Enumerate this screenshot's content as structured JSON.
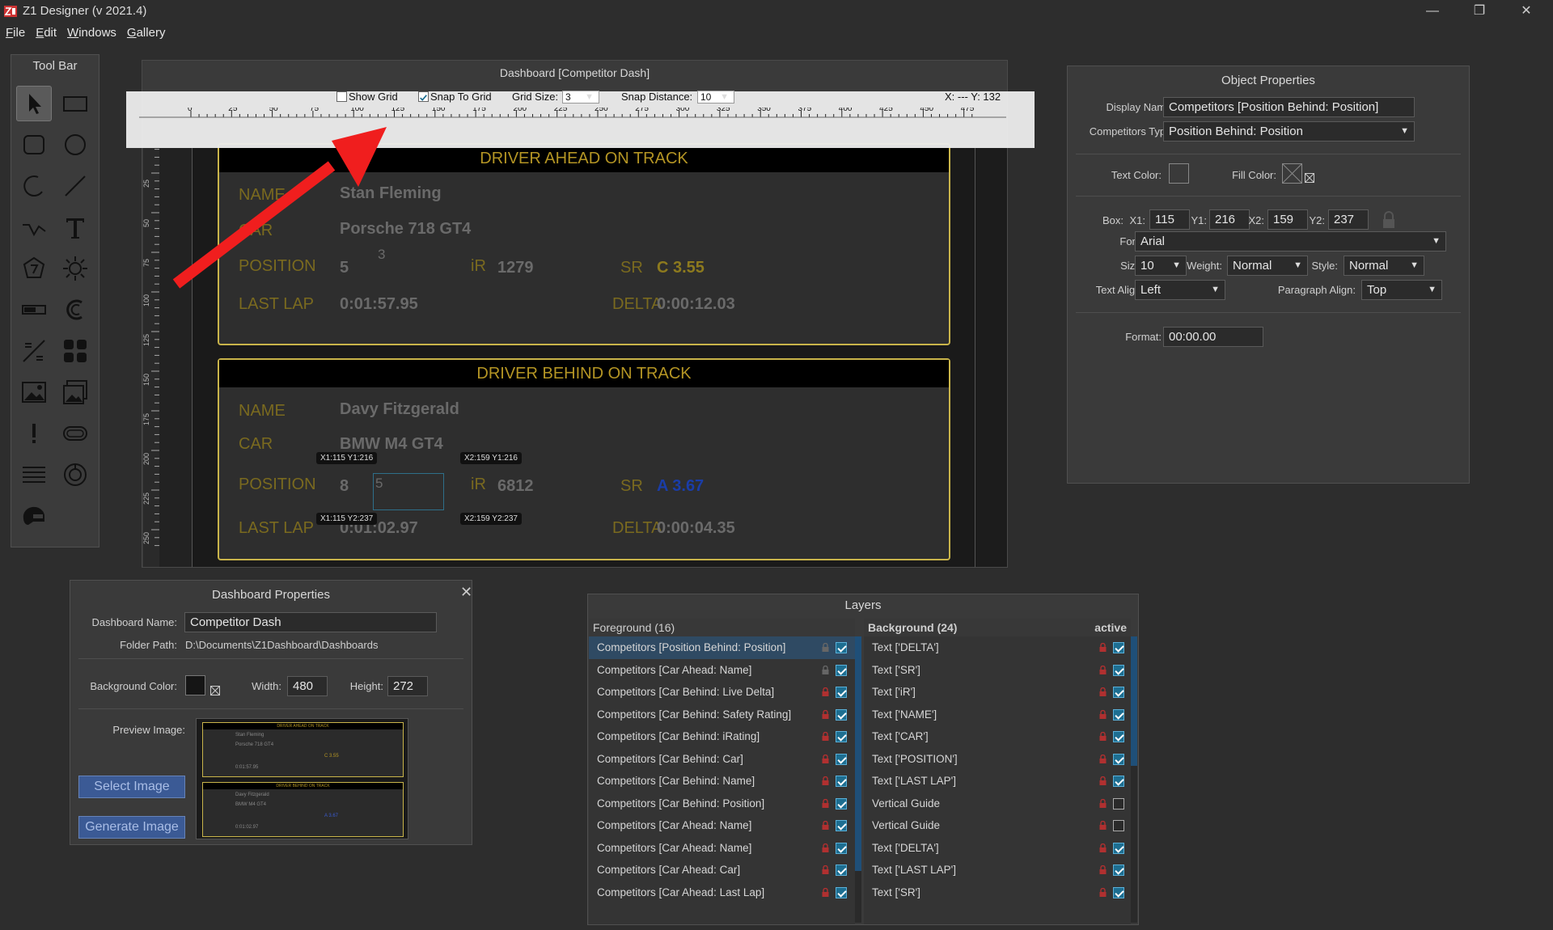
{
  "window": {
    "title": "Z1 Designer (v 2021.4)",
    "minimize": "—",
    "restore": "❐",
    "close": "✕"
  },
  "menu": [
    "File",
    "Edit",
    "Windows",
    "Gallery"
  ],
  "toolbar": {
    "title": "Tool Bar"
  },
  "editor": {
    "title": "Dashboard [Competitor Dash]",
    "show_grid_label": "Show Grid",
    "snap_label": "Snap To Grid",
    "grid_size_label": "Grid Size:",
    "grid_size": "3",
    "snap_distance_label": "Snap Distance:",
    "snap_distance": "10",
    "coords": "X: --- Y: 132",
    "ruler_ticks": [
      "0",
      "25",
      "50",
      "75",
      "100",
      "125",
      "150",
      "175",
      "200",
      "225",
      "250",
      "275",
      "300",
      "325",
      "350",
      "375",
      "400",
      "425",
      "450",
      "475"
    ],
    "vruler_ticks": [
      "0",
      "25",
      "50",
      "75",
      "100",
      "125",
      "150",
      "175",
      "200",
      "225",
      "250"
    ]
  },
  "card_ahead": {
    "header": "DRIVER AHEAD ON TRACK",
    "name_lbl": "NAME",
    "name": "Stan Fleming",
    "car_lbl": "CAR",
    "car": "Porsche 718 GT4",
    "pos_lbl": "POSITION",
    "pos": "5",
    "pos_sub": "3",
    "ir_lbl": "iR",
    "ir": "1279",
    "sr_lbl": "SR",
    "sr": "C 3.55",
    "lap_lbl": "LAST LAP",
    "lap": "0:01:57.95",
    "delta_lbl": "DELTA",
    "delta": "0:00:12.03"
  },
  "card_behind": {
    "header": "DRIVER BEHIND ON TRACK",
    "name_lbl": "NAME",
    "name": "Davy Fitzgerald",
    "car_lbl": "CAR",
    "car": "BMW M4 GT4",
    "pos_lbl": "POSITION",
    "pos": "8",
    "pos_sub": "5",
    "ir_lbl": "iR",
    "ir": "6812",
    "sr_lbl": "SR",
    "sr": "A 3.67",
    "lap_lbl": "LAST LAP",
    "lap": "0:01:02.97",
    "delta_lbl": "DELTA",
    "delta": "0:00:04.35"
  },
  "handles": {
    "tl": "X1:115 Y1:216",
    "tr": "X2:159 Y1:216",
    "bl": "X1:115 Y2:237",
    "br": "X2:159 Y2:237"
  },
  "objprops": {
    "title": "Object Properties",
    "display_name_lbl": "Display Name:",
    "display_name": "Competitors [Position Behind: Position]",
    "comp_type_lbl": "Competitors Type:",
    "comp_type": "Position Behind: Position",
    "text_color_lbl": "Text Color:",
    "fill_color_lbl": "Fill Color:",
    "box_lbl": "Box:",
    "x1_lbl": "X1:",
    "x1": "115",
    "y1_lbl": "Y1:",
    "y1": "216",
    "x2_lbl": "X2:",
    "x2": "159",
    "y2_lbl": "Y2:",
    "y2": "237",
    "font_lbl": "Font:",
    "font": "Arial",
    "size_lbl": "Size:",
    "size": "10",
    "weight_lbl": "Weight:",
    "weight": "Normal",
    "style_lbl": "Style:",
    "style": "Normal",
    "talign_lbl": "Text Align:",
    "talign": "Left",
    "palign_lbl": "Paragraph Align:",
    "palign": "Top",
    "format_lbl": "Format:",
    "format": "00:00.00"
  },
  "dashprops": {
    "title": "Dashboard Properties",
    "close": "✕",
    "name_lbl": "Dashboard Name:",
    "name": "Competitor Dash",
    "folder_lbl": "Folder Path:",
    "folder": "D:\\Documents\\Z1Dashboard\\Dashboards",
    "bg_lbl": "Background Color:",
    "width_lbl": "Width:",
    "width": "480",
    "height_lbl": "Height:",
    "height": "272",
    "preview_lbl": "Preview Image:",
    "select_btn": "Select Image",
    "generate_btn": "Generate Image"
  },
  "layers": {
    "title": "Layers",
    "fg_head": "Foreground (16)",
    "bg_head": "Background (24)",
    "active_lbl": "active",
    "foreground": [
      "Competitors [Position Behind: Position]",
      "Competitors [Car Ahead: Name]",
      "Competitors [Car Behind: Live Delta]",
      "Competitors [Car Behind: Safety Rating]",
      "Competitors [Car Behind: iRating]",
      "Competitors [Car Behind: Car]",
      "Competitors [Car Behind: Name]",
      "Competitors [Car Behind: Position]",
      "Competitors [Car Ahead: Name]",
      "Competitors [Car Ahead: Name]",
      "Competitors [Car Ahead: Car]",
      "Competitors [Car Ahead: Last Lap]"
    ],
    "background": [
      "Text ['DELTA']",
      "Text ['SR']",
      "Text ['iR']",
      "Text ['NAME']",
      "Text ['CAR']",
      "Text ['POSITION']",
      "Text ['LAST LAP']",
      "Vertical Guide",
      "Vertical Guide",
      "Text ['DELTA']",
      "Text ['LAST LAP']",
      "Text ['SR']"
    ],
    "bg_active": [
      true,
      true,
      true,
      true,
      true,
      true,
      true,
      false,
      false,
      true,
      true,
      true
    ]
  }
}
